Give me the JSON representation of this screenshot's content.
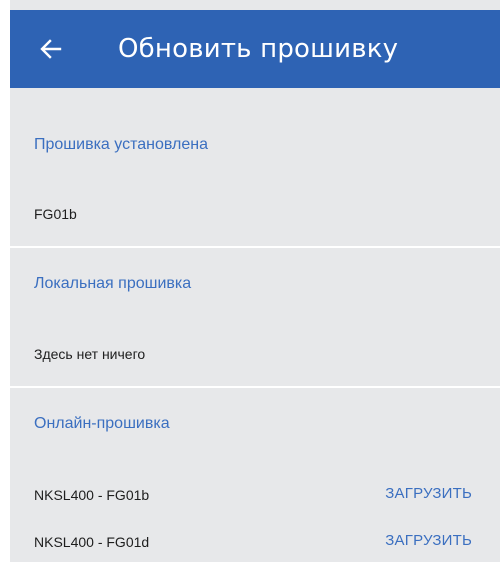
{
  "header": {
    "title": "Обновить прошивку",
    "back_icon": "arrow-left-icon"
  },
  "colors": {
    "app_bar": "#2e63b4",
    "accent": "#3b6fc0",
    "background": "#e7e8ea"
  },
  "installed": {
    "title": "Прошивка установлена",
    "value": "FG01b"
  },
  "local": {
    "title": "Локальная прошивка",
    "value": "Здесь нет ничего"
  },
  "online": {
    "title": "Онлайн-прошивка",
    "items": [
      {
        "name": "NKSL400 - FG01b",
        "action": "ЗАГРУЗИТЬ"
      },
      {
        "name": "NKSL400 - FG01d",
        "action": "ЗАГРУЗИТЬ"
      }
    ]
  }
}
